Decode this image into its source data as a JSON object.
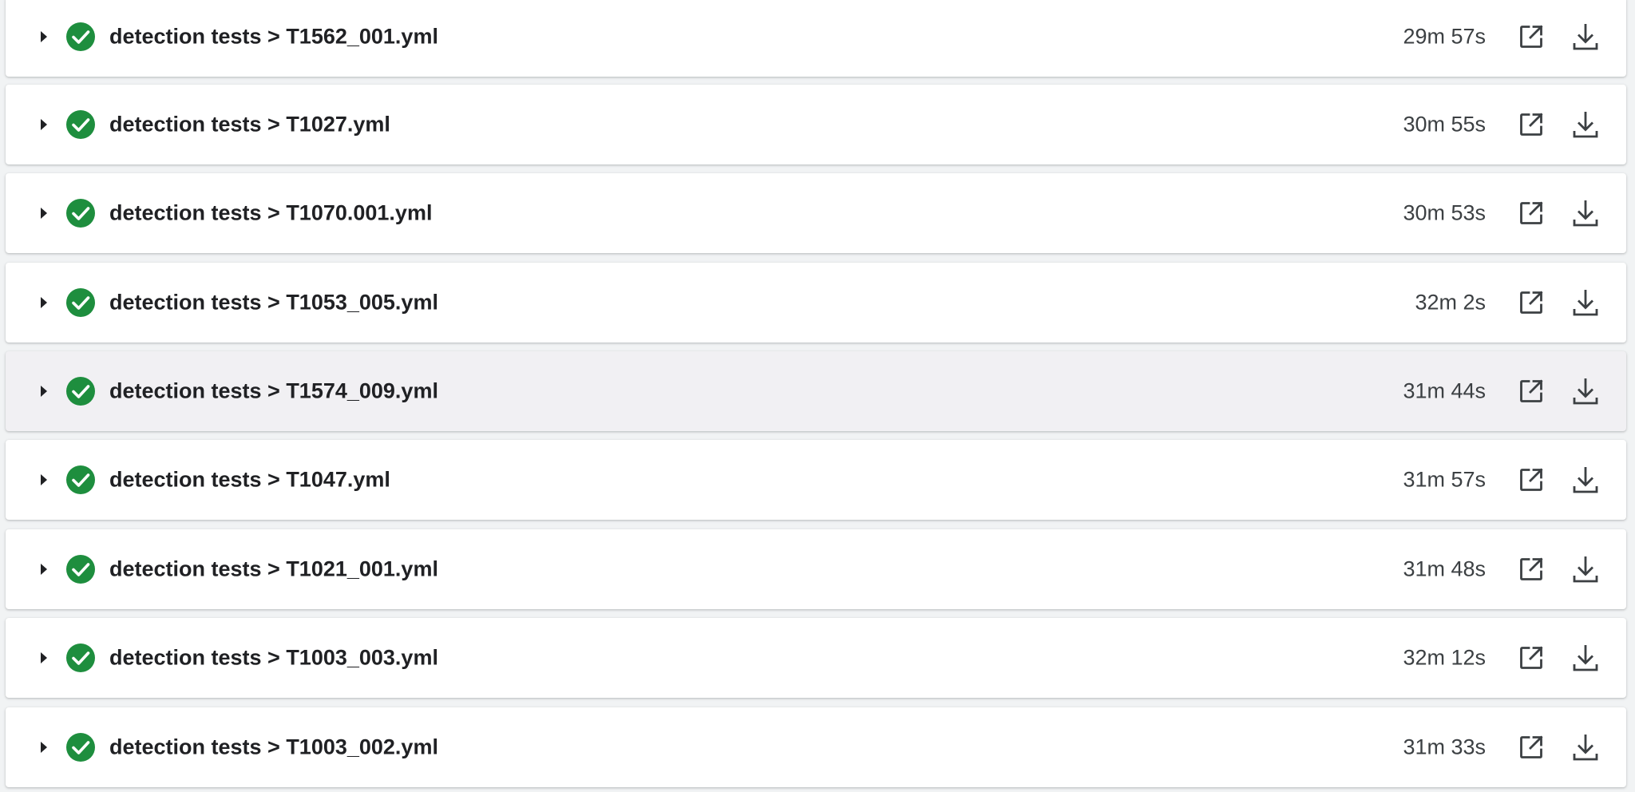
{
  "icons": {
    "expand": "caret-right-icon",
    "status": "check-circle-icon",
    "open": "open-in-new-icon",
    "download": "download-icon"
  },
  "colors": {
    "success": "#1e8e3e",
    "hover_row": "#f1f0f3"
  },
  "jobs": [
    {
      "name": "detection tests > T1562_001.yml",
      "duration": "29m 57s",
      "status": "passed"
    },
    {
      "name": "detection tests > T1027.yml",
      "duration": "30m 55s",
      "status": "passed"
    },
    {
      "name": "detection tests > T1070.001.yml",
      "duration": "30m 53s",
      "status": "passed"
    },
    {
      "name": "detection tests > T1053_005.yml",
      "duration": "32m 2s",
      "status": "passed"
    },
    {
      "name": "detection tests > T1574_009.yml",
      "duration": "31m 44s",
      "status": "passed"
    },
    {
      "name": "detection tests > T1047.yml",
      "duration": "31m 57s",
      "status": "passed"
    },
    {
      "name": "detection tests > T1021_001.yml",
      "duration": "31m 48s",
      "status": "passed"
    },
    {
      "name": "detection tests > T1003_003.yml",
      "duration": "32m 12s",
      "status": "passed"
    },
    {
      "name": "detection tests > T1003_002.yml",
      "duration": "31m 33s",
      "status": "passed"
    }
  ]
}
